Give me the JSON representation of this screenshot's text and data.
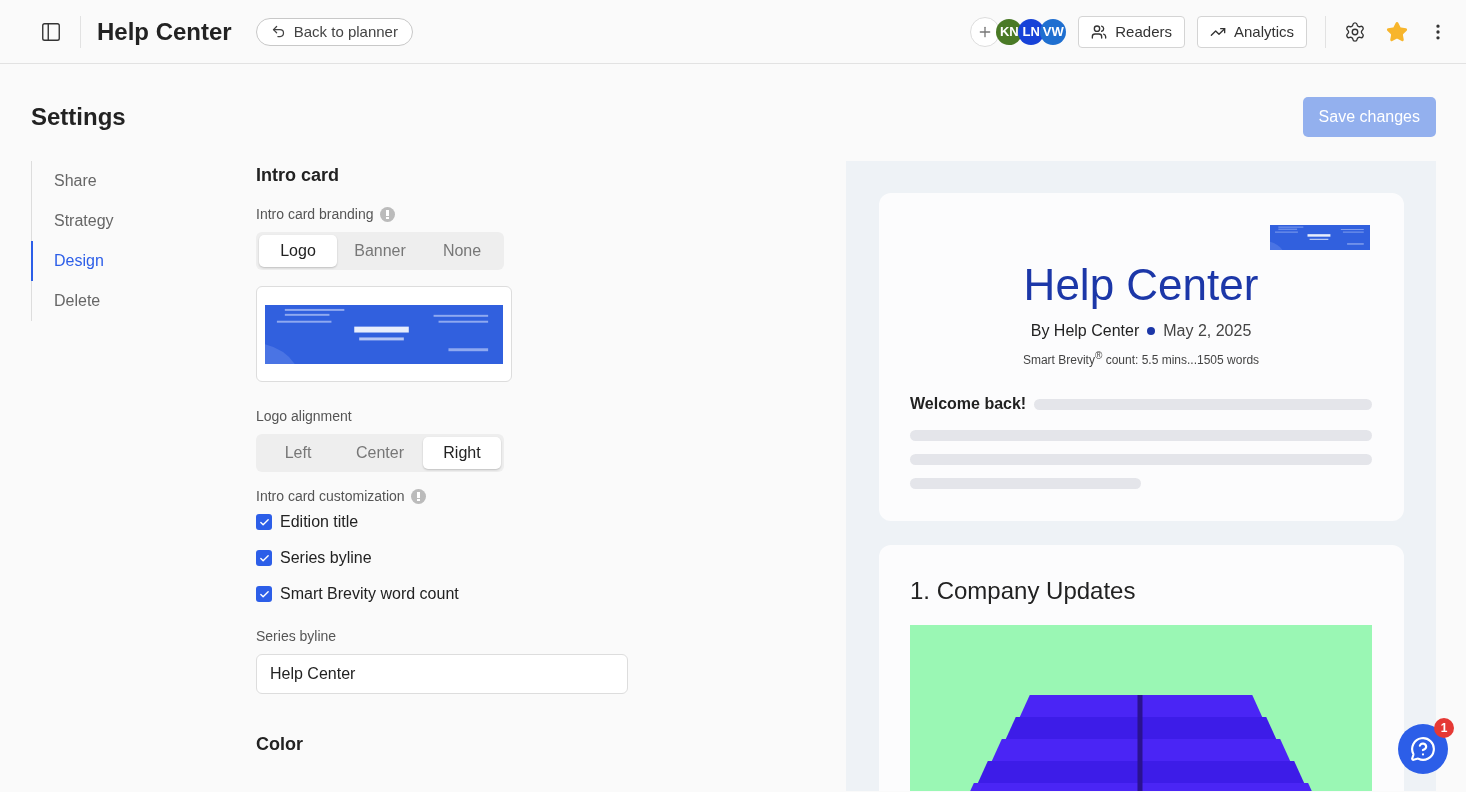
{
  "header": {
    "title": "Help Center",
    "back_button": "Back to planner",
    "avatars": [
      {
        "initials": "KN",
        "color": "#4a7a26"
      },
      {
        "initials": "LN",
        "color": "#1742d8"
      },
      {
        "initials": "VW",
        "color": "#1f6fd0"
      }
    ],
    "buttons": [
      {
        "kind": "readers",
        "label": "Readers"
      },
      {
        "kind": "analytics",
        "label": "Analytics"
      }
    ],
    "starred": true
  },
  "page": {
    "title": "Settings",
    "save_button": {
      "label": "Save changes",
      "disabled": true
    }
  },
  "nav": [
    {
      "label": "Share",
      "selected": false
    },
    {
      "label": "Strategy",
      "selected": false
    },
    {
      "label": "Design",
      "selected": true
    },
    {
      "label": "Delete",
      "selected": false
    }
  ],
  "form": {
    "section_title": "Intro card",
    "branding": {
      "label": "Intro card branding",
      "options": [
        {
          "label": "Logo",
          "selected": true
        },
        {
          "label": "Banner",
          "selected": false
        },
        {
          "label": "None",
          "selected": false
        }
      ]
    },
    "alignment": {
      "label": "Logo alignment",
      "options": [
        {
          "label": "Left",
          "selected": false
        },
        {
          "label": "Center",
          "selected": false
        },
        {
          "label": "Right",
          "selected": true
        }
      ]
    },
    "customization": {
      "label": "Intro card customization",
      "items": [
        {
          "label": "Edition title",
          "checked": true
        },
        {
          "label": "Series byline",
          "checked": true
        },
        {
          "label": "Smart Brevity word count",
          "checked": true
        }
      ]
    },
    "byline": {
      "label": "Series byline",
      "value": "Help Center"
    },
    "next_section": "Color"
  },
  "preview": {
    "title": "Help Center",
    "byline": "By Help Center",
    "date": "May 2, 2025",
    "count": "Smart Brevity$^{®}$ count: 5.5 mins...1505 words",
    "welcome": "Welcome back!",
    "section_title": "1. Company Updates"
  },
  "help_widget": {
    "badge": "1"
  }
}
